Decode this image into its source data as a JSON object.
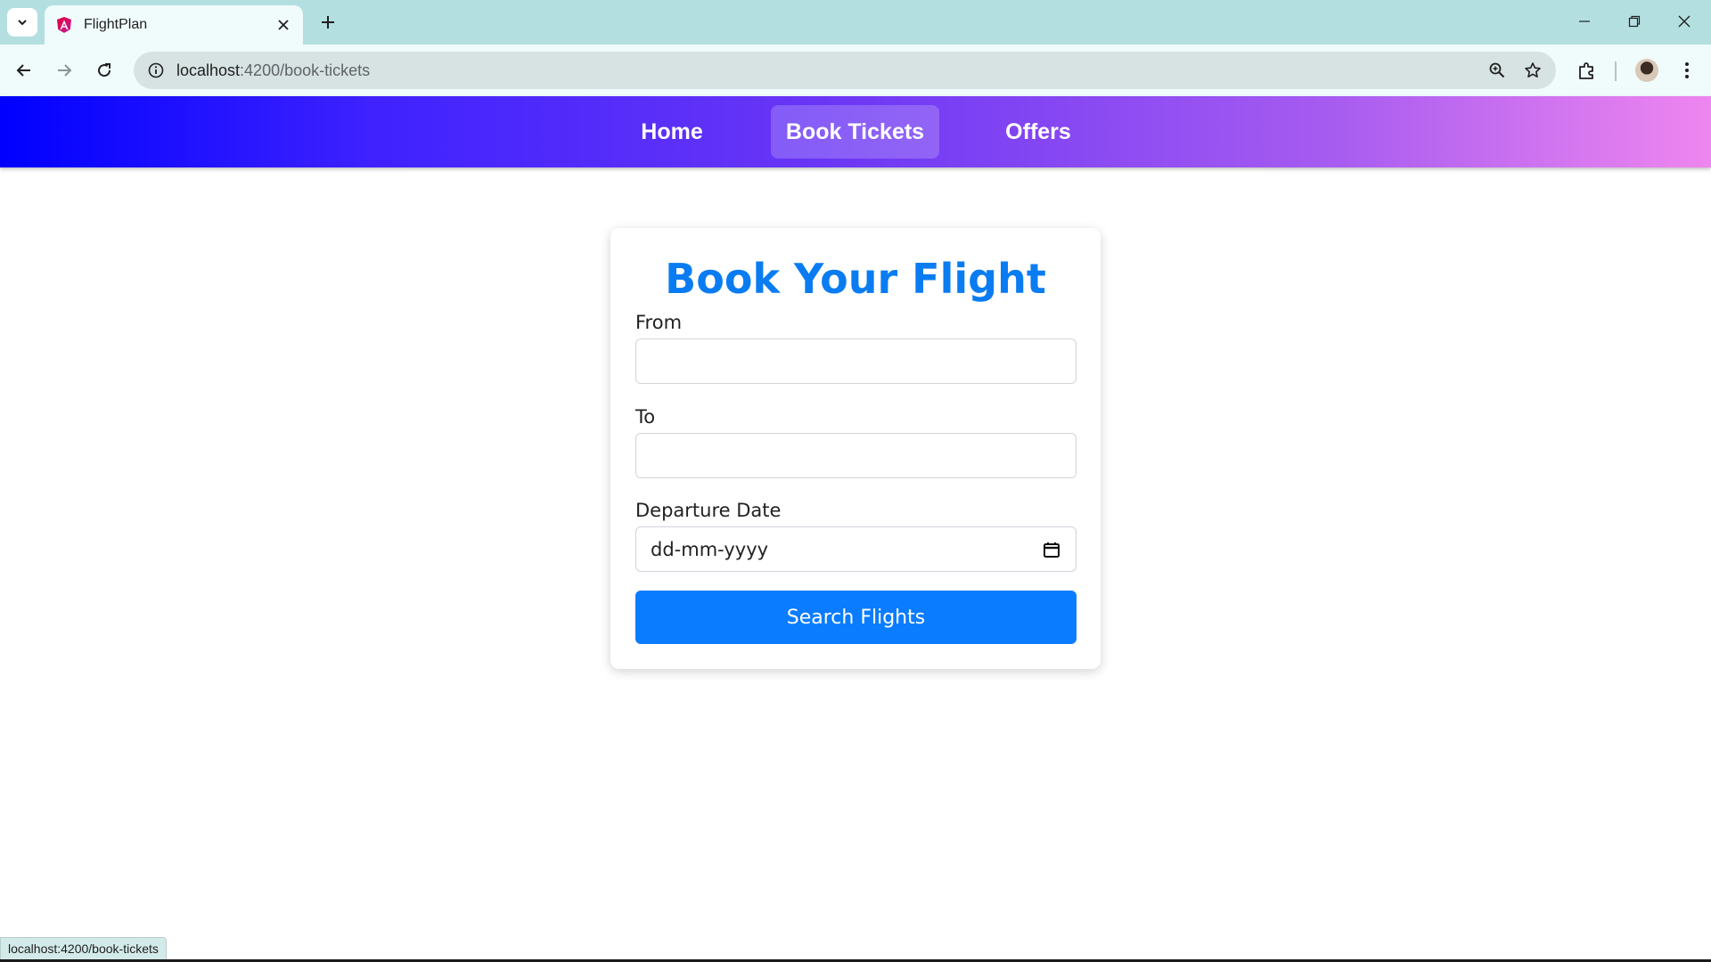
{
  "browser": {
    "tab_title": "FlightPlan",
    "url_host": "localhost",
    "url_path": ":4200/book-tickets",
    "status_url": "localhost:4200/book-tickets"
  },
  "navbar": {
    "links": [
      {
        "label": "Home",
        "active": false
      },
      {
        "label": "Book Tickets",
        "active": true
      },
      {
        "label": "Offers",
        "active": false
      }
    ],
    "gradient_colors": [
      "#0000ff",
      "#6a36f5",
      "#ef86ef"
    ]
  },
  "form": {
    "title": "Book Your Flight",
    "from_label": "From",
    "from_value": "",
    "to_label": "To",
    "to_value": "",
    "date_label": "Departure Date",
    "date_placeholder": "dd-mm-yyyy",
    "submit_label": "Search Flights",
    "accent_color": "#0a7cff"
  },
  "icons": {
    "tab_list": "chevron-down-icon",
    "favicon": "angular-icon",
    "tab_close": "close-icon",
    "new_tab": "plus-icon",
    "back": "arrow-left-icon",
    "forward": "arrow-right-icon",
    "reload": "reload-icon",
    "site_info": "info-icon",
    "zoom": "zoom-icon",
    "bookmark": "star-icon",
    "extensions": "puzzle-icon",
    "menu": "kebab-icon",
    "calendar": "calendar-icon"
  }
}
